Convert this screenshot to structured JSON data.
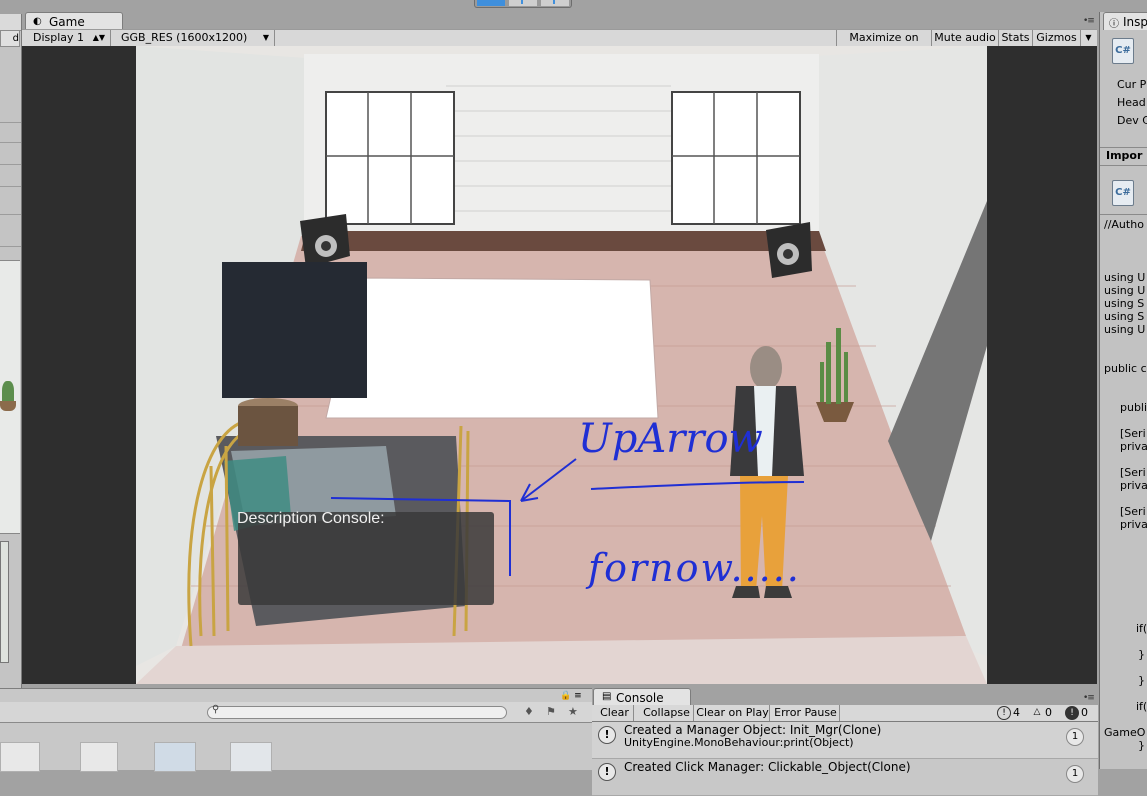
{
  "game_tab": {
    "label": "Game",
    "icon": "pacman-icon"
  },
  "toolbar": {
    "display": "Display 1",
    "resolution": "GGB_RES (1600x1200)",
    "maximize": "Maximize on Play",
    "mute": "Mute audio",
    "stats": "Stats",
    "gizmos": "Gizmos"
  },
  "scene": {
    "description_console": "Description Console:",
    "annotation_1": "UpArrow",
    "annotation_2": "fornow....."
  },
  "console": {
    "tab_label": "Console",
    "clear": "Clear",
    "collapse": "Collapse",
    "clear_on_play": "Clear on Play",
    "error_pause": "Error Pause",
    "info_count": "4",
    "warn_count": "0",
    "error_count": "0",
    "entries": [
      {
        "line1": "Created a Manager Object: Init_Mgr(Clone)",
        "line2": "UnityEngine.MonoBehaviour:print(Object)",
        "count": "1"
      },
      {
        "line1": "Created Click Manager: Clickable_Object(Clone)",
        "line2": "",
        "count": "1"
      }
    ]
  },
  "inspector": {
    "tab_label": "Insp",
    "props": [
      "Cur P",
      "Head",
      "Dev C"
    ],
    "imported_header": "Impor",
    "code": [
      "//Autho",
      "using U",
      "using U",
      "using S",
      "using S",
      "using U",
      "public c",
      "publi",
      "[Seri",
      "priva",
      "[Seri",
      "priva",
      "[Seri",
      "priva",
      "if(",
      "}",
      "}",
      "if(",
      "GameO",
      "}"
    ]
  },
  "colors": {
    "annotation": "#1f2fd4",
    "accent": "#3f8fdc"
  }
}
